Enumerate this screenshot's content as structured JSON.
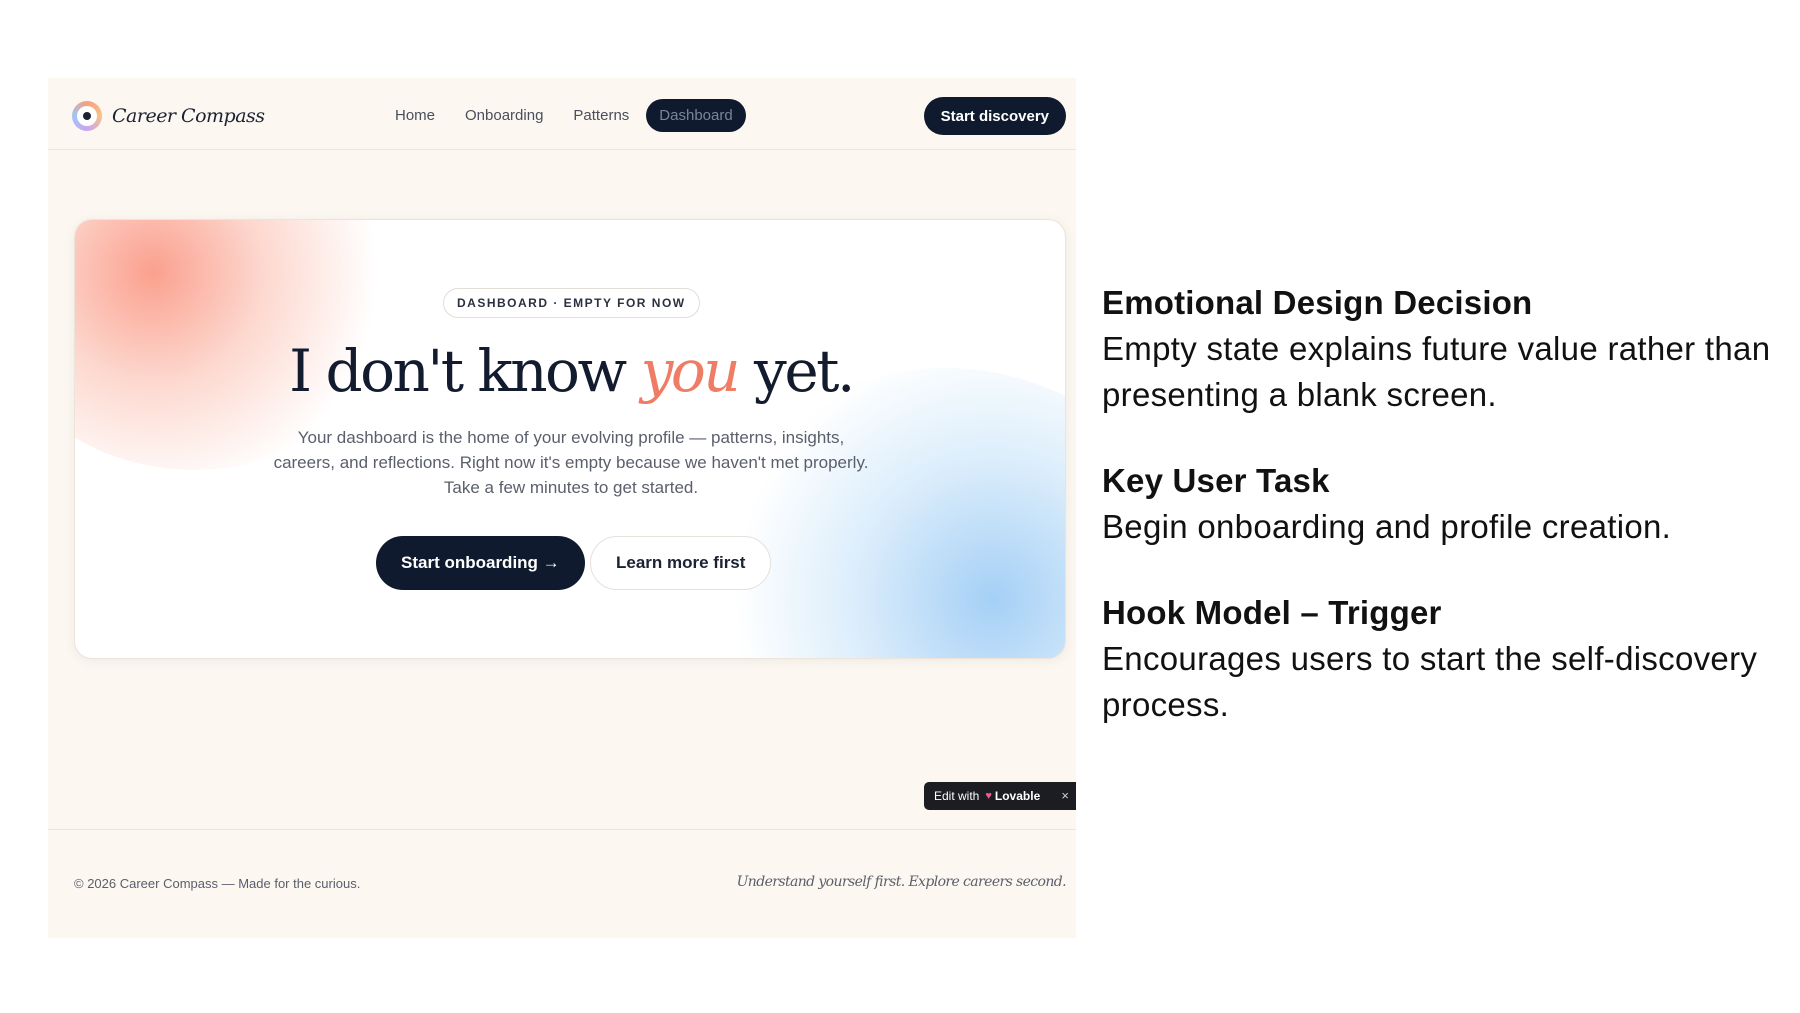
{
  "app": {
    "brand_name": "Career Compass",
    "nav_links": [
      "Home",
      "Onboarding",
      "Patterns",
      "Dashboard"
    ],
    "active_nav": "Dashboard",
    "cta_top": "Start discovery"
  },
  "hero": {
    "pill": "DASHBOARD · EMPTY FOR NOW",
    "headline_pre": "I don't know",
    "headline_accent": "you",
    "headline_post": "yet.",
    "body": "Your dashboard is the home of your evolving profile — patterns, insights, careers, and reflections. Right now it's empty because we haven't met properly. Take a few minutes to get started.",
    "primary_button": "Start onboarding →",
    "secondary_button": "Learn more first"
  },
  "badge": {
    "prefix": "Edit with",
    "brand": "Lovable",
    "close": "×"
  },
  "footer": {
    "left": "© 2026 Career Compass — Made for the curious.",
    "right": "Understand yourself first. Explore careers second."
  },
  "notes": [
    {
      "title": "Emotional Design Decision",
      "text": "Empty state explains future value rather than presenting a blank screen."
    },
    {
      "title": "Key User Task",
      "text": "Begin onboarding and profile creation."
    },
    {
      "title": "Hook Model – Trigger",
      "text": "Encourages users to start the self-discovery process."
    }
  ],
  "colors": {
    "navy": "#0f1a2e",
    "accent": "#ef7d66",
    "page_bg": "#fcf7f1"
  }
}
